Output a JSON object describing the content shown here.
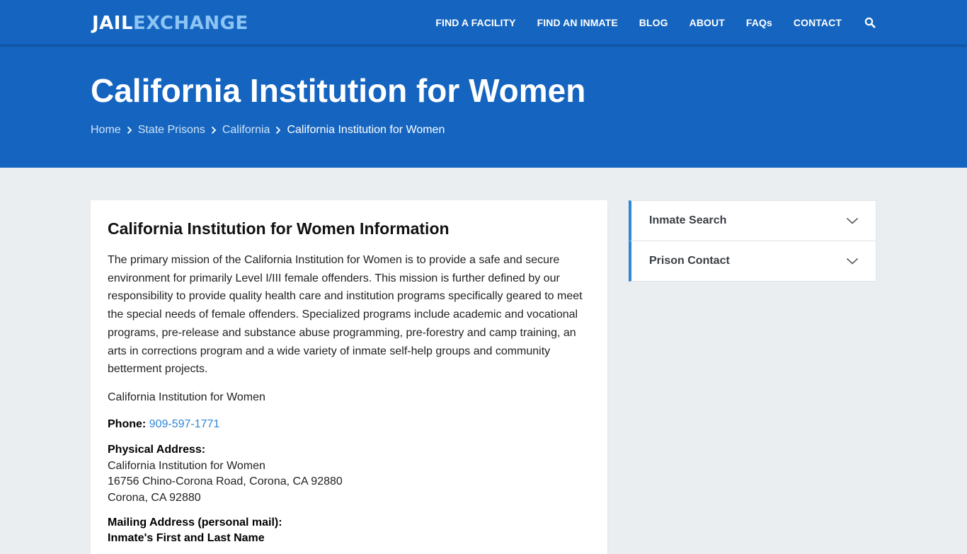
{
  "header": {
    "logo_part1": "JAIL",
    "logo_part2": "EXCHANGE",
    "nav": [
      {
        "label": "FIND A FACILITY"
      },
      {
        "label": "FIND AN INMATE"
      },
      {
        "label": "BLOG"
      },
      {
        "label": "ABOUT"
      },
      {
        "label": "FAQs"
      },
      {
        "label": "CONTACT"
      }
    ],
    "search_icon": "search-icon"
  },
  "hero": {
    "title": "California Institution for Women",
    "breadcrumbs": [
      {
        "label": "Home"
      },
      {
        "label": "State Prisons"
      },
      {
        "label": "California"
      }
    ],
    "breadcrumb_current": "California Institution for Women"
  },
  "main": {
    "heading": "California Institution for Women Information",
    "description": "The primary mission of the California Institution for Women is to provide a safe and secure environment for primarily Level I/III female offenders. This mission is further defined by our responsibility to provide quality health care and institution programs specifically geared to meet the special needs of female offenders. Specialized programs include academic and vocational programs, pre-release and substance abuse programming, pre-forestry and camp training, an arts in corrections program and a wide variety of inmate self-help groups and community betterment projects.",
    "facility_name": "California Institution for Women",
    "phone_label": "Phone:",
    "phone_value": "909-597-1771",
    "physical_label": "Physical Address:",
    "physical_lines": [
      "California Institution for Women",
      "16756 Chino-Corona Road, Corona, CA 92880",
      "Corona, CA 92880"
    ],
    "mailing_label": "Mailing Address (personal mail):",
    "mailing_lines": [
      "Inmate's First and Last Name"
    ]
  },
  "sidebar": {
    "items": [
      {
        "label": "Inmate Search"
      },
      {
        "label": "Prison Contact"
      }
    ]
  },
  "colors": {
    "brand_blue": "#1565c0",
    "link_blue": "#2f86d8",
    "logo_accent": "#8cc4f5"
  }
}
